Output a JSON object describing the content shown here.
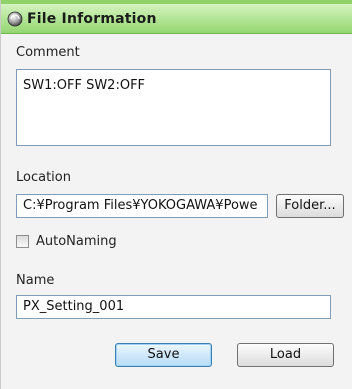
{
  "title": "File Information",
  "comment": {
    "label": "Comment",
    "value": "SW1:OFF SW2:OFF"
  },
  "location": {
    "label": "Location",
    "value": "C:¥Program Files¥YOKOGAWA¥Powe",
    "folder_button": "Folder..."
  },
  "auto_naming": {
    "label": "AutoNaming",
    "checked": false
  },
  "name": {
    "label": "Name",
    "value": "PX_Setting_001"
  },
  "buttons": {
    "save": "Save",
    "load": "Load"
  },
  "colors": {
    "title_bar": "#b6e79a",
    "accent_green": "#8fd26a"
  }
}
